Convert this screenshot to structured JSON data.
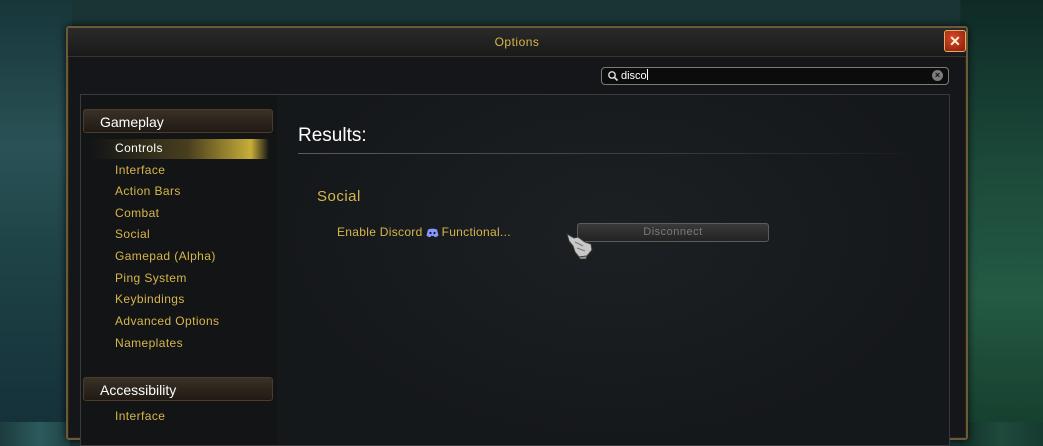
{
  "window": {
    "title": "Options",
    "close_label": "✕"
  },
  "search": {
    "value": "disco",
    "clear_label": "×"
  },
  "sidebar": {
    "categories": [
      {
        "label": "Gameplay"
      },
      {
        "label": "Accessibility"
      }
    ],
    "gameplay_items": [
      {
        "label": "Controls",
        "selected": true
      },
      {
        "label": "Interface"
      },
      {
        "label": "Action Bars"
      },
      {
        "label": "Combat"
      },
      {
        "label": "Social"
      },
      {
        "label": "Gamepad (Alpha)"
      },
      {
        "label": "Ping System"
      },
      {
        "label": "Keybindings"
      },
      {
        "label": "Advanced Options"
      },
      {
        "label": "Nameplates"
      }
    ],
    "accessibility_items": [
      {
        "label": "Interface"
      }
    ]
  },
  "main": {
    "results_title": "Results:",
    "section_title": "Social",
    "setting": {
      "label_prefix": "Enable Discord",
      "label_suffix": "Functional...",
      "button_label": "Disconnect"
    }
  },
  "colors": {
    "gold": "#d8b64a",
    "accent": "#d94a2a"
  },
  "icons": [
    "search-icon",
    "clear-icon",
    "close-icon",
    "discord-icon",
    "gauntlet-cursor-icon"
  ]
}
